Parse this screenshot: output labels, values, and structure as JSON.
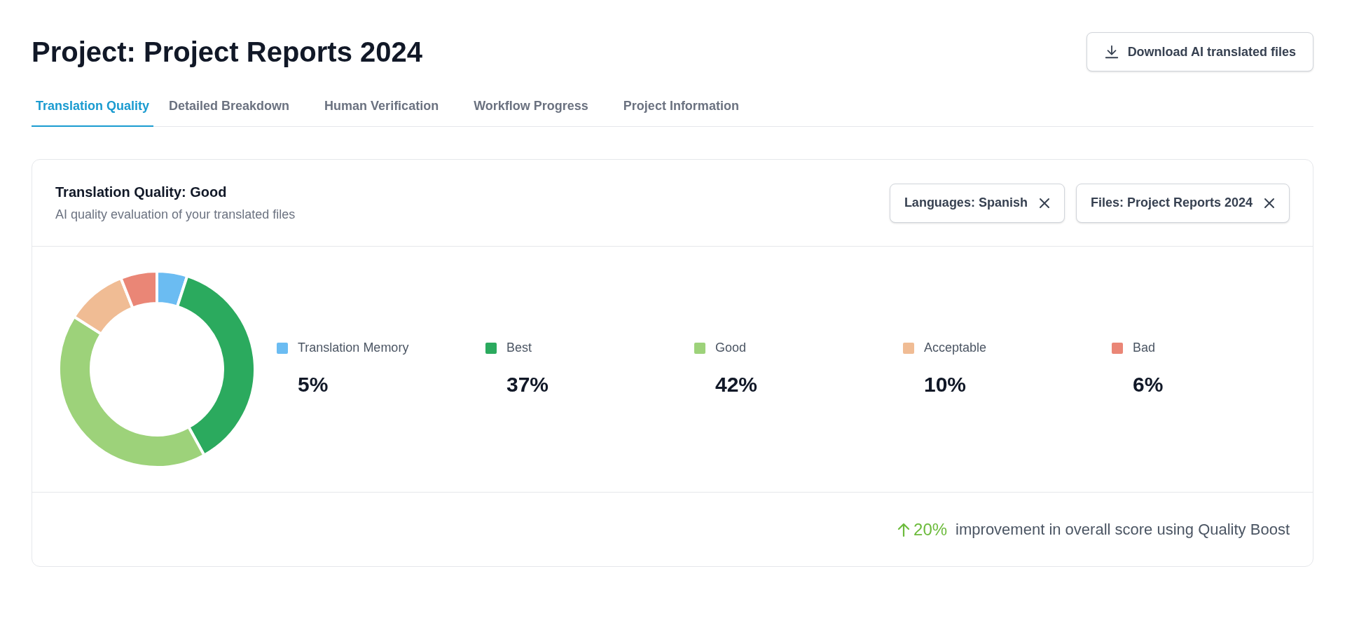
{
  "page": {
    "title": "Project: Project Reports 2024"
  },
  "download_button": {
    "label": "Download AI translated files"
  },
  "tabs": [
    {
      "label": "Translation Quality",
      "selected": true
    },
    {
      "label": "Detailed Breakdown",
      "selected": false
    },
    {
      "label": "Human Verification",
      "selected": false
    },
    {
      "label": "Workflow Progress",
      "selected": false
    },
    {
      "label": "Project Information",
      "selected": false
    }
  ],
  "card": {
    "title": "Translation Quality: Good",
    "subtitle": "AI quality evaluation of your translated files",
    "filters": [
      {
        "label": "Languages: Spanish"
      },
      {
        "label": "Files: Project Reports 2024"
      }
    ],
    "legend": [
      {
        "value": "5%",
        "color": "#6bbcf2"
      },
      {
        "value": "37%",
        "color": "#2baa5e"
      },
      {
        "value": "42%",
        "color": "#9dd27a"
      },
      {
        "value": "10%",
        "color": "#f0bc94"
      },
      {
        "value": "6%",
        "color": "#ea8676"
      }
    ],
    "chart_data": {
      "type": "donut",
      "categories": [
        "Translation Memory",
        "Best",
        "Good",
        "Acceptable",
        "Bad"
      ],
      "values": [
        5,
        37,
        42,
        10,
        6
      ]
    },
    "footer": {
      "change": "20%",
      "text": "improvement in overall score using Quality Boost"
    }
  }
}
